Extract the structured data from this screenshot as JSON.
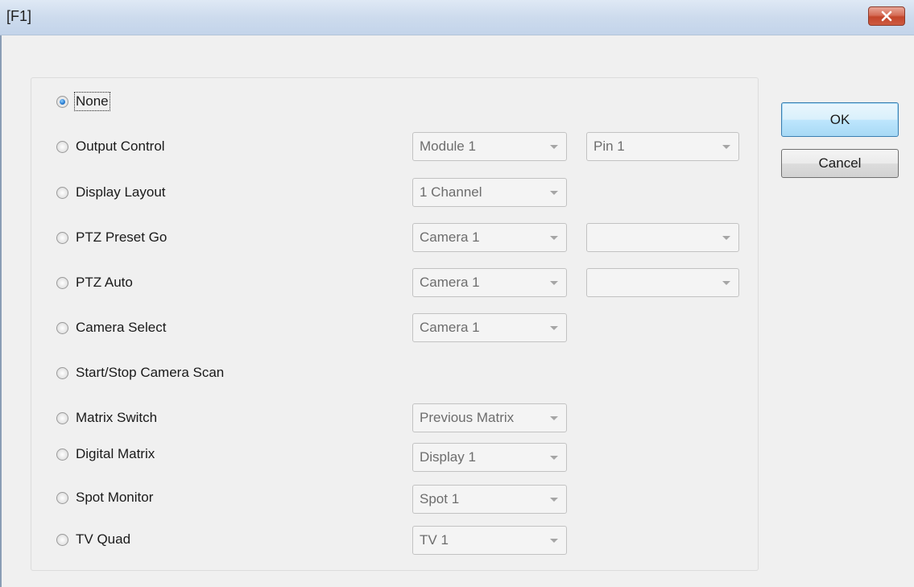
{
  "window": {
    "title": "[F1]"
  },
  "buttons": {
    "ok": "OK",
    "cancel": "Cancel"
  },
  "options": [
    {
      "label": "None",
      "selected": true
    },
    {
      "label": "Output Control",
      "combos": [
        "Module 1",
        "Pin 1"
      ]
    },
    {
      "label": "Display Layout",
      "combos": [
        "1 Channel"
      ]
    },
    {
      "label": "PTZ Preset Go",
      "combos": [
        "Camera 1",
        ""
      ]
    },
    {
      "label": "PTZ Auto",
      "combos": [
        "Camera 1",
        ""
      ]
    },
    {
      "label": "Camera Select",
      "combos": [
        "Camera 1"
      ]
    },
    {
      "label": "Start/Stop Camera Scan"
    },
    {
      "label": "Matrix Switch",
      "combos": [
        "Previous Matrix"
      ]
    },
    {
      "label": "Digital Matrix",
      "combos": [
        "Display 1"
      ]
    },
    {
      "label": "Spot Monitor",
      "combos": [
        "Spot 1"
      ]
    },
    {
      "label": "TV Quad",
      "combos": [
        "TV 1"
      ]
    }
  ],
  "icons": {
    "close": "close-icon",
    "dropdown": "chevron-down-icon"
  }
}
